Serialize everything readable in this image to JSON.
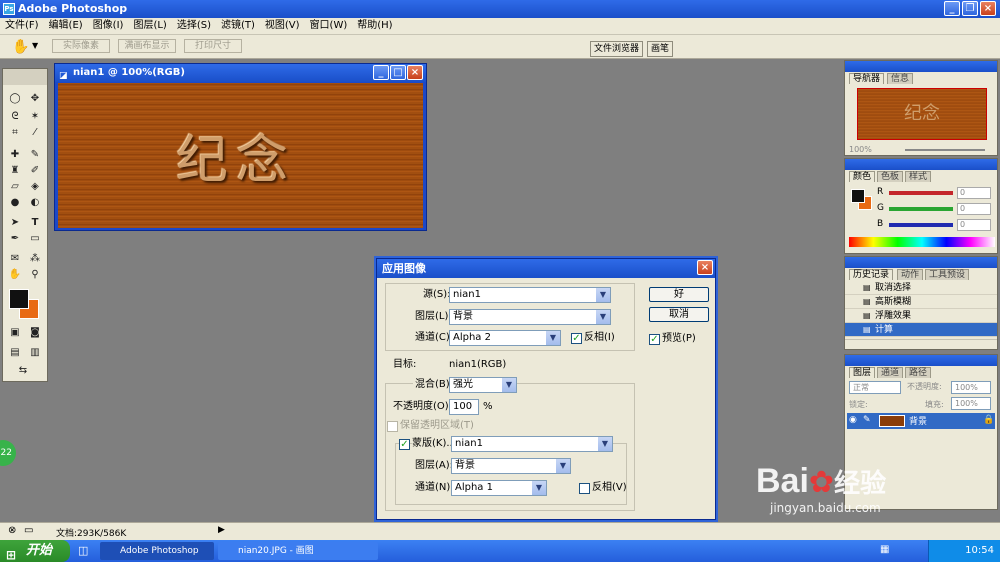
{
  "app": {
    "title": "Adobe Photoshop"
  },
  "menu": [
    "文件(F)",
    "编辑(E)",
    "图像(I)",
    "图层(L)",
    "选择(S)",
    "滤镜(T)",
    "视图(V)",
    "窗口(W)",
    "帮助(H)"
  ],
  "options_bar": {
    "buttons": [
      "实际像素",
      "满画布显示",
      "打印尺寸"
    ],
    "palette_well": [
      "文件浏览器",
      "画笔"
    ]
  },
  "document": {
    "title": "nian1 @ 100%(RGB)",
    "text": "纪念"
  },
  "dialog": {
    "title": "应用图像",
    "source_label": "源(S):",
    "source_value": "nian1",
    "layer_label": "图层(L):",
    "layer_value": "背景",
    "channel_label": "通道(C):",
    "channel_value": "Alpha 2",
    "invert_label": "反相(I)",
    "invert_checked": true,
    "target_label": "目标:",
    "target_value": "nian1(RGB)",
    "blend_label": "混合(B):",
    "blend_value": "强光",
    "opacity_label": "不透明度(O):",
    "opacity_value": "100",
    "opacity_unit": "%",
    "preserve_label": "保留透明区域(T)",
    "mask_label": "蒙版(K)...",
    "mask_checked": true,
    "mask_value": "nian1",
    "mask_layer_label": "图层(A):",
    "mask_layer_value": "背景",
    "mask_channel_label": "通道(N):",
    "mask_channel_value": "Alpha 1",
    "mask_invert_label": "反相(V)",
    "mask_invert_checked": false,
    "ok_label": "好",
    "cancel_label": "取消",
    "preview_label": "预览(P)",
    "preview_checked": true
  },
  "navigator": {
    "tabs": [
      "导航器",
      "信息"
    ],
    "zoom": "100%",
    "thumb_text": "纪念"
  },
  "color": {
    "tabs": [
      "颜色",
      "色板",
      "样式"
    ],
    "channels": [
      {
        "label": "R",
        "value": "0",
        "color": "#c4262b"
      },
      {
        "label": "G",
        "value": "0",
        "color": "#2aa532"
      },
      {
        "label": "B",
        "value": "0",
        "color": "#1f2bb0"
      }
    ]
  },
  "history": {
    "tabs": [
      "历史记录",
      "动作",
      "工具预设"
    ],
    "items": [
      "取消选择",
      "高斯模糊",
      "浮雕效果",
      "计算"
    ],
    "selected": 3
  },
  "layers": {
    "tabs": [
      "图层",
      "通道",
      "路径"
    ],
    "mode": "正常",
    "opacity_label": "不透明度:",
    "opacity": "100%",
    "lock_label": "锁定:",
    "fill_label": "填充:",
    "fill": "100%",
    "layer_name": "背景"
  },
  "status": {
    "doc_size": "文档:293K/586K"
  },
  "taskbar": {
    "start": "开始",
    "tasks": [
      "Adobe Photoshop",
      "nian20.JPG - 画图"
    ],
    "clock": "10:54"
  },
  "side_badge": "22",
  "watermark": {
    "brand": "Bai",
    "brand2": "经验",
    "url": "jingyan.baidu.com"
  }
}
